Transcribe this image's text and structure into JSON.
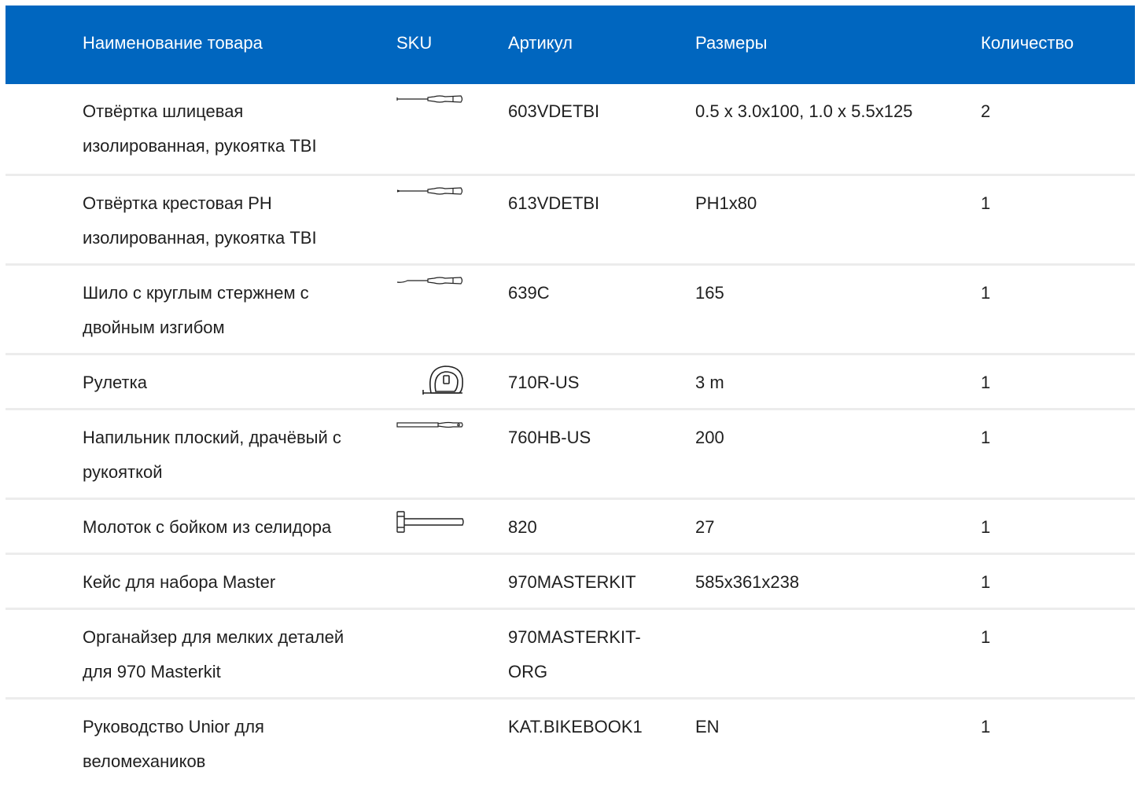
{
  "header": {
    "name": "Наименование товара",
    "sku": "SKU",
    "article": "Артикул",
    "size": "Размеры",
    "qty": "Количество"
  },
  "rows": [
    {
      "name": "Отвёртка шлицевая изолированная, рукоятка TBI",
      "icon": "flat-screwdriver-icon",
      "article": "603VDETBI",
      "size": "0.5 x 3.0x100, 1.0 x 5.5x125",
      "qty": "2"
    },
    {
      "name": "Отвёртка крестовая PH изолированная, рукоятка TBI",
      "icon": "phillips-screwdriver-icon",
      "article": "613VDETBI",
      "size": "PH1x80",
      "qty": "1"
    },
    {
      "name": "Шило с круглым стержнем с двойным изгибом",
      "icon": "awl-icon",
      "article": "639C",
      "size": "165",
      "qty": "1"
    },
    {
      "name": "Рулетка",
      "icon": "tape-measure-icon",
      "article": "710R-US",
      "size": "3 m",
      "qty": "1"
    },
    {
      "name": "Напильник плоский, драчёвый с рукояткой",
      "icon": "file-tool-icon",
      "article": "760HB-US",
      "size": "200",
      "qty": "1"
    },
    {
      "name": "Молоток с бойком из селидора",
      "icon": "hammer-icon",
      "article": "820",
      "size": "27",
      "qty": "1"
    },
    {
      "name": "Кейс для набора Master",
      "icon": "",
      "article": "970MASTERKIT",
      "size": "585x361x238",
      "qty": "1"
    },
    {
      "name": "Органайзер для мелких деталей для 970 Masterkit",
      "icon": "",
      "article": "970MASTERKIT-ORG",
      "size": "",
      "qty": "1"
    },
    {
      "name": "Руководство Unior для веломехаников",
      "icon": "",
      "article": "KAT.BIKEBOOK1",
      "size": "EN",
      "qty": "1"
    }
  ],
  "colors": {
    "header_bg": "#0066bf",
    "header_text": "#ffffff",
    "separator": "#ececec"
  }
}
